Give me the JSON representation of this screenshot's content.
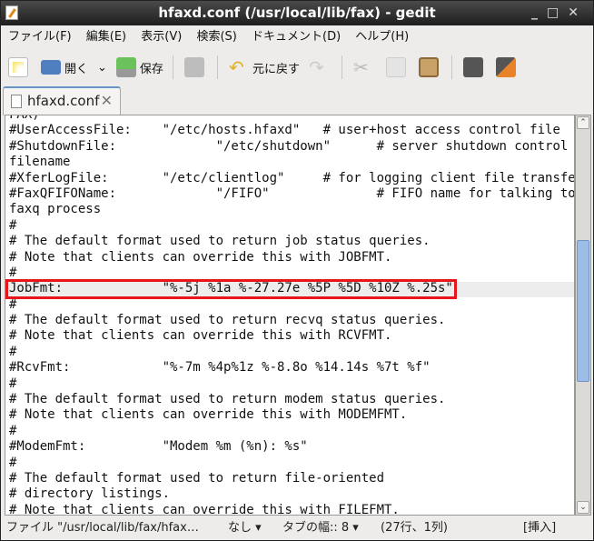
{
  "window": {
    "title": "hfaxd.conf (/usr/local/lib/fax) - gedit",
    "controls": [
      "_",
      "□",
      "✕"
    ]
  },
  "menu": [
    "ファイル(F)",
    "編集(E)",
    "表示(V)",
    "検索(S)",
    "ドキュメント(D)",
    "ヘルプ(H)"
  ],
  "toolbar": {
    "open": "開く",
    "save": "保存",
    "undo": "元に戻す"
  },
  "tab": {
    "label": "hfaxd.conf",
    "close": "✕"
  },
  "editor": {
    "lines": [
      "FAX)",
      "#UserAccessFile:    \"/etc/hosts.hfaxd\"   # user+host access control file",
      "#ShutdownFile:             \"/etc/shutdown\"      # server shutdown control",
      "filename",
      "#XferLogFile:       \"/etc/clientlog\"     # for logging client file transfers",
      "#FaxQFIFOName:             \"/FIFO\"              # FIFO name for talking to",
      "faxq process",
      "#",
      "# The default format used to return job status queries.",
      "# Note that clients can override this with JOBFMT.",
      "#",
      "JobFmt:             \"%-5j %1a %-27.27e %5P %5D %10Z %.25s\"",
      "#",
      "# The default format used to return recvq status queries.",
      "# Note that clients can override this with RCVFMT.",
      "#",
      "#RcvFmt:            \"%-7m %4p%1z %-8.8o %14.14s %7t %f\"",
      "#",
      "# The default format used to return modem status queries.",
      "# Note that clients can override this with MODEMFMT.",
      "#",
      "#ModemFmt:          \"Modem %m (%n): %s\"",
      "#",
      "# The default format used to return file-oriented",
      "# directory listings.",
      "# Note that clients can override this with FILEFMT."
    ]
  },
  "status": {
    "file": "ファイル \"/usr/local/lib/fax/hfax…",
    "syntax": "なし ▾",
    "tabwidth": "タブの幅:: 8 ▾",
    "position": "(27行、1列)",
    "mode": "[挿入]"
  },
  "colors": {
    "highlight_box": "#e8161b",
    "scroll_thumb": "#9dbde6"
  }
}
